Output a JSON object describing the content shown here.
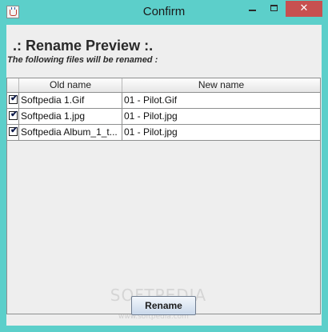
{
  "window": {
    "title": "Confirm",
    "close_glyph": "✕",
    "colors": {
      "frame": "#5ccfca",
      "close_button": "#c75050",
      "content_bg": "#eeeeee"
    }
  },
  "icons": {
    "app": "java-cup-icon",
    "minimize": "minimize-icon",
    "maximize": "maximize-icon",
    "close": "close-icon",
    "checkbox": "checkmark-icon"
  },
  "preview": {
    "heading": ".: Rename Preview :.",
    "subheading": "The following files will be renamed :",
    "columns": {
      "old": "Old name",
      "new": "New name"
    },
    "check_glyph": "✔",
    "rows": [
      {
        "checked": true,
        "old": "Softpedia 1.Gif",
        "new": "01 - Pilot.Gif"
      },
      {
        "checked": true,
        "old": "Softpedia 1.jpg",
        "new": "01 - Pilot.jpg"
      },
      {
        "checked": true,
        "old": "Softpedia Album_1_t...",
        "new": "01 - Pilot.jpg"
      }
    ]
  },
  "actions": {
    "rename_label": "Rename"
  },
  "watermark": {
    "text": "SOFTPEDIA",
    "url": "www.softpedia.com"
  }
}
